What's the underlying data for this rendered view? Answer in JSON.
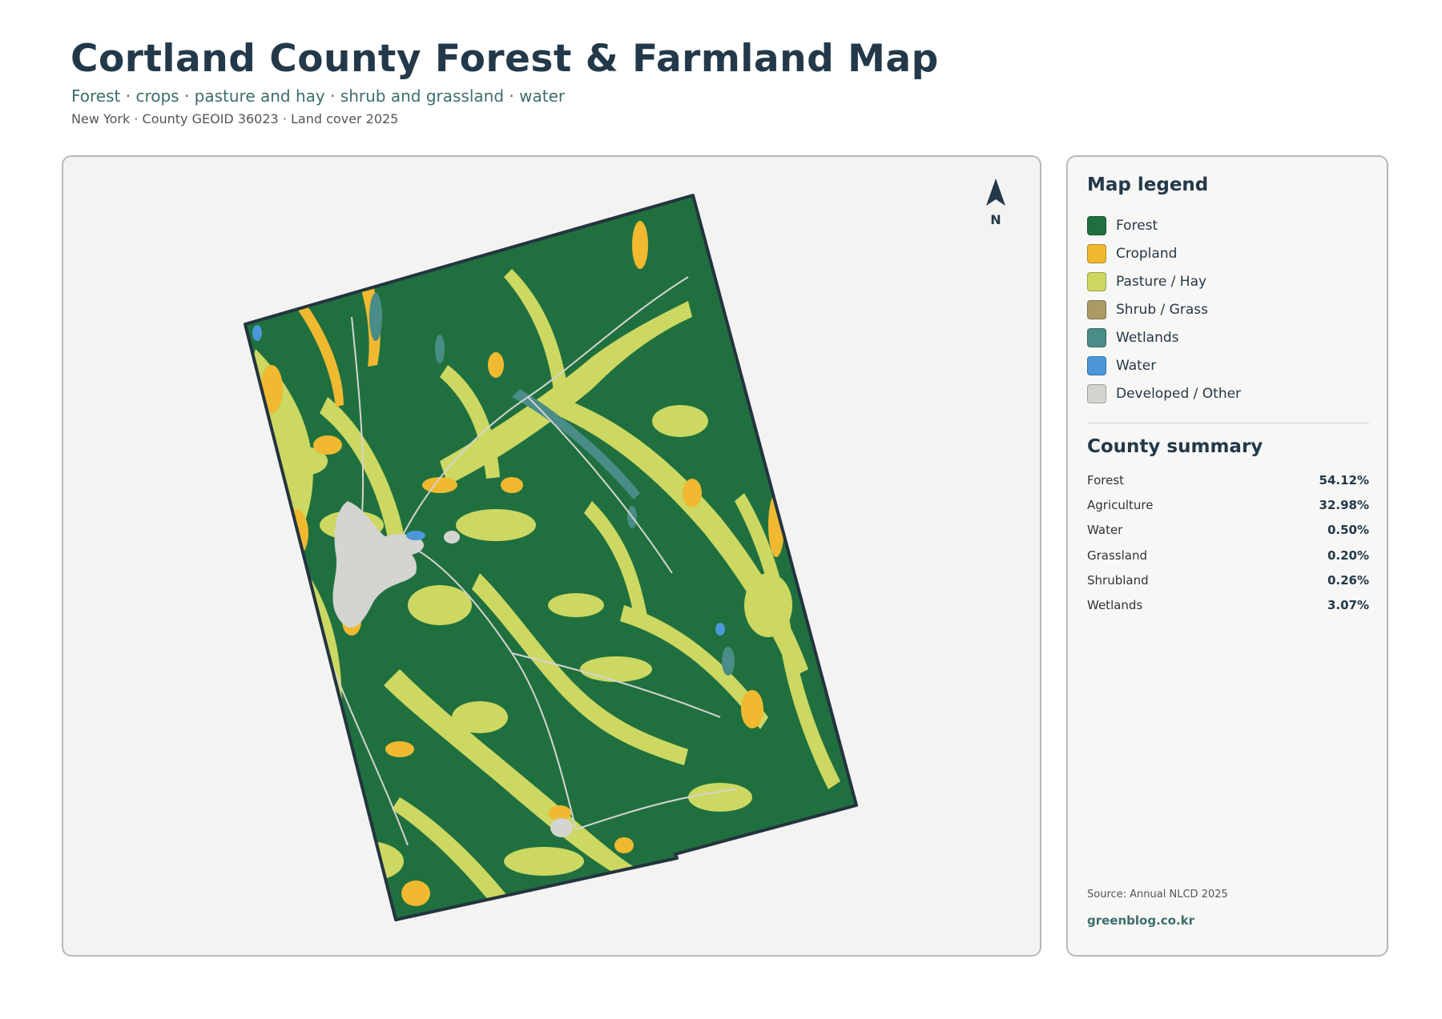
{
  "header": {
    "title": "Cortland County Forest & Farmland Map",
    "subtitle": "Forest · crops · pasture and hay · shrub and grassland · water",
    "meta": "New York · County GEOID 36023 · Land cover 2025"
  },
  "map": {
    "north_label": "N"
  },
  "legend": {
    "title": "Map legend",
    "items": [
      {
        "label": "Forest",
        "color": "#20703f"
      },
      {
        "label": "Cropland",
        "color": "#f0b930"
      },
      {
        "label": "Pasture / Hay",
        "color": "#ccd862"
      },
      {
        "label": "Shrub / Grass",
        "color": "#ab9a65"
      },
      {
        "label": "Wetlands",
        "color": "#4a8c87"
      },
      {
        "label": "Water",
        "color": "#4b97d9"
      },
      {
        "label": "Developed / Other",
        "color": "#d4d4d0"
      }
    ]
  },
  "summary": {
    "title": "County summary",
    "rows": [
      {
        "name": "Forest",
        "value": "54.12%"
      },
      {
        "name": "Agriculture",
        "value": "32.98%"
      },
      {
        "name": "Water",
        "value": "0.50%"
      },
      {
        "name": "Grassland",
        "value": "0.20%"
      },
      {
        "name": "Shrubland",
        "value": "0.26%"
      },
      {
        "name": "Wetlands",
        "value": "3.07%"
      }
    ]
  },
  "footer": {
    "source": "Source: Annual NLCD 2025",
    "brand": "greenblog.co.kr"
  }
}
